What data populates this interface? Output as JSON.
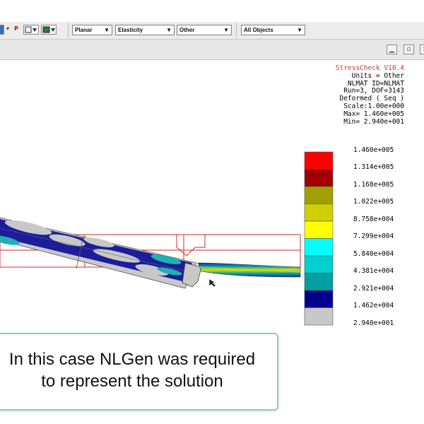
{
  "toolbar": {
    "p_label": "P",
    "dropdowns": [
      {
        "value": "Planar"
      },
      {
        "value": "Elasticity"
      },
      {
        "value": "Other"
      },
      {
        "value": "All Objects"
      }
    ]
  },
  "info": {
    "title": "StressCheck V10.4",
    "lines": [
      "Units = Other",
      "NLMAT ID=NLMAT",
      "Run=3, DOF=3143",
      "Deformed ( Seq )",
      "Scale:1.00e+000",
      "Max= 1.460e+005",
      "Min= 2.940e+001"
    ]
  },
  "legend": {
    "labels": [
      "1.460e+005",
      "1.314e+005",
      "1.168e+005",
      "1.022e+005",
      "8.758e+004",
      "7.299e+004",
      "5.840e+004",
      "4.381e+004",
      "2.921e+004",
      "1.462e+004",
      "2.940e+001"
    ],
    "colors": [
      "#ff0000",
      "#a00000",
      "#a0a000",
      "#d0d000",
      "#ffff00",
      "#00ffff",
      "#00d0d0",
      "#00a0a0",
      "#00008c",
      "#c8c8c8"
    ]
  },
  "caption": {
    "line1": "In this case NLGen was required",
    "line2": "to represent the solution"
  }
}
